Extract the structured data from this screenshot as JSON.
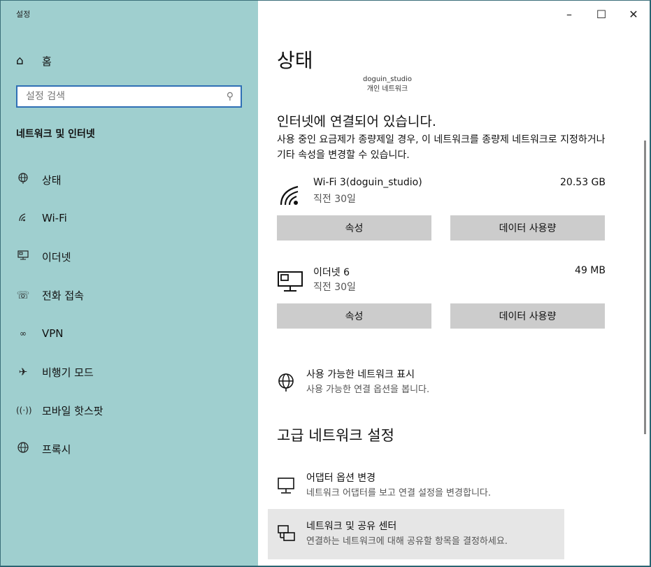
{
  "window": {
    "title": "설정",
    "min": "–",
    "max": "☐",
    "close": "✕"
  },
  "sidebar": {
    "home_label": "홈",
    "search_placeholder": "설정 검색",
    "section_title": "네트워크 및 인터넷",
    "items": [
      {
        "label": "상태",
        "icon": "globe-status-icon"
      },
      {
        "label": "Wi-Fi",
        "icon": "wifi-icon"
      },
      {
        "label": "이더넷",
        "icon": "ethernet-icon"
      },
      {
        "label": "전화 접속",
        "icon": "dialup-icon"
      },
      {
        "label": "VPN",
        "icon": "vpn-icon"
      },
      {
        "label": "비행기 모드",
        "icon": "airplane-icon"
      },
      {
        "label": "모바일 핫스팟",
        "icon": "hotspot-icon"
      },
      {
        "label": "프록시",
        "icon": "proxy-icon"
      }
    ]
  },
  "main": {
    "page_title": "상태",
    "network_name": "doguin_studio",
    "network_type": "개인 네트워크",
    "status_heading": "인터넷에 연결되어 있습니다.",
    "status_desc": "사용 중인 요금제가 종량제일 경우, 이 네트워크를 종량제 네트워크로 지정하거나 기타 속성을 변경할 수 있습니다.",
    "connections": [
      {
        "name": "Wi-Fi 3(doguin_studio)",
        "sub": "직전 30일",
        "size": "20.53 GB",
        "icon": "wifi-icon"
      },
      {
        "name": "이더넷 6",
        "sub": "직전 30일",
        "size": "49 MB",
        "icon": "ethernet-icon"
      }
    ],
    "btn_properties": "속성",
    "btn_data_usage": "데이터 사용량",
    "show_networks": {
      "title": "사용 가능한 네트워크 표시",
      "sub": "사용 가능한 연결 옵션을 봅니다."
    },
    "advanced_heading": "고급 네트워크 설정",
    "adapter": {
      "title": "어댑터 옵션 변경",
      "sub": "네트워크 어댑터를 보고 연결 설정을 변경합니다."
    },
    "sharing": {
      "title": "네트워크 및 공유 센터",
      "sub": "연결하는 네트워크에 대해 공유할 항목을 결정하세요."
    }
  }
}
